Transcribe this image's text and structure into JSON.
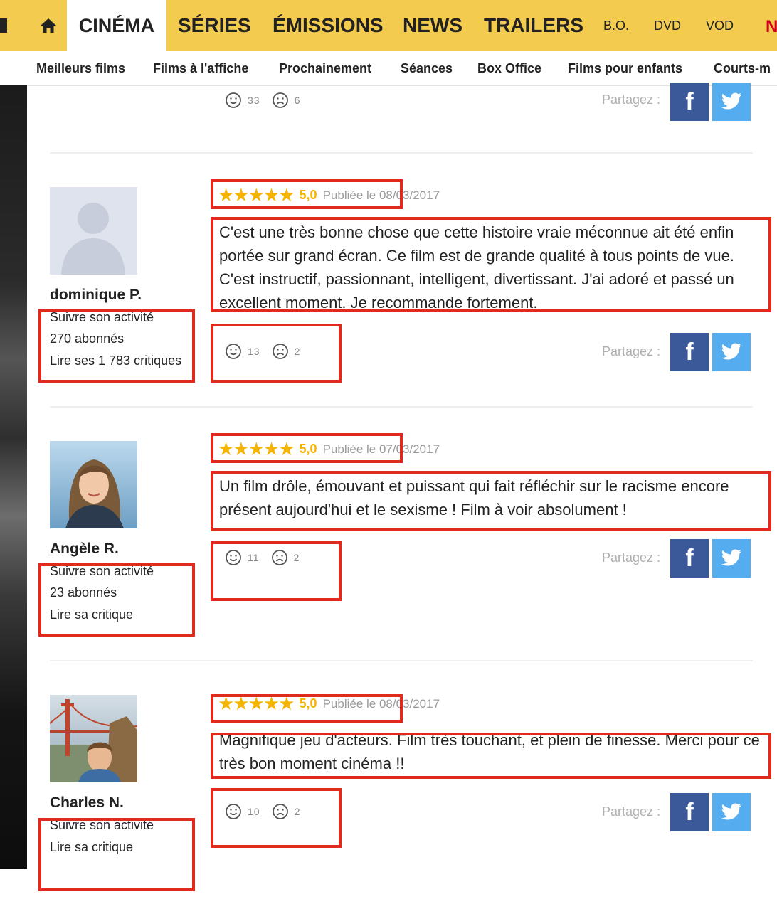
{
  "top_nav": {
    "items": [
      "CINÉMA",
      "SÉRIES",
      "ÉMISSIONS",
      "NEWS",
      "TRAILERS",
      "B.O.",
      "DVD",
      "VOD"
    ],
    "active": "CINÉMA",
    "colors": {
      "bar": "#f3cc4f",
      "active_bg": "#ffffff",
      "edge_logo": "#d0021b"
    }
  },
  "sub_nav": {
    "items": [
      "Meilleurs films",
      "Films à l'affiche",
      "Prochainement",
      "Séances",
      "Box Office",
      "Films pour enfants",
      "Courts-m"
    ]
  },
  "previous_review": {
    "likes": "33",
    "dislikes": "6",
    "share_label": "Partagez :"
  },
  "reviews": [
    {
      "user": {
        "name": "dominique P.",
        "follow": "Suivre son activité",
        "followers": "270 abonnés",
        "reviews_link": "Lire ses 1 783 critiques",
        "avatar": "default-avatar-icon"
      },
      "stars": "★★★★★",
      "score": "5,0",
      "published": "Publiée le 08/03/2017",
      "text": "C'est une très bonne chose que cette histoire vraie méconnue ait été enfin portée sur grand écran. Ce film est de grande qualité à tous points de vue. C'est instructif, passionnant, intelligent, divertissant. J'ai adoré et passé un excellent moment. Je recommande fortement.",
      "likes": "13",
      "dislikes": "2",
      "share_label": "Partagez :"
    },
    {
      "user": {
        "name": "Angèle R.",
        "follow": "Suivre son activité",
        "followers": "23 abonnés",
        "reviews_link": "Lire sa critique",
        "avatar": "woman-photo"
      },
      "stars": "★★★★★",
      "score": "5,0",
      "published": "Publiée le 07/03/2017",
      "text": "Un film drôle, émouvant et puissant qui fait réfléchir sur le racisme encore présent aujourd'hui et le sexisme ! Film à voir absolument !",
      "likes": "11",
      "dislikes": "2",
      "share_label": "Partagez :"
    },
    {
      "user": {
        "name": "Charles N.",
        "follow": "Suivre son activité",
        "reviews_link": "Lire sa critique",
        "avatar": "golden-gate-photo"
      },
      "stars": "★★★★★",
      "score": "5,0",
      "published": "Publiée le 08/03/2017",
      "text": "Magnifique jeu d'acteurs. Film très touchant, et plein de finesse. Merci pour ce très bon moment cinéma !!",
      "likes": "10",
      "dislikes": "2",
      "share_label": "Partagez :"
    }
  ],
  "colors": {
    "star": "#f5b400",
    "facebook": "#3b5998",
    "twitter": "#55acee",
    "annotation_box": "#e02a1e"
  }
}
